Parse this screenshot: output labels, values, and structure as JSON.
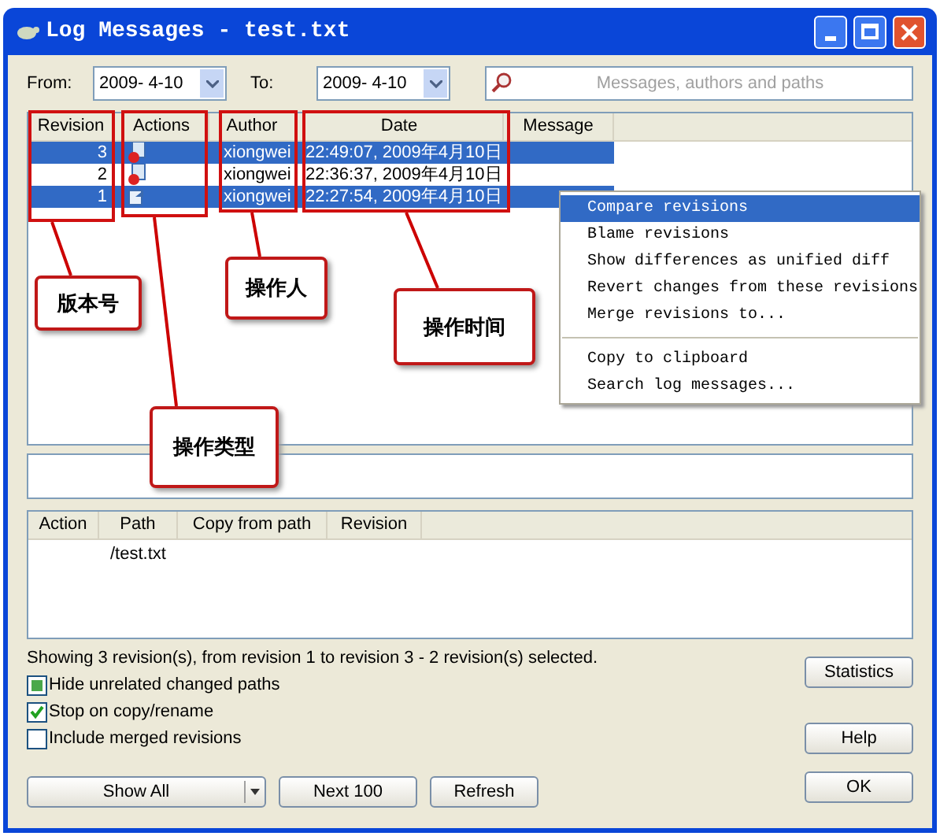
{
  "window": {
    "title": "Log Messages - test.txt"
  },
  "filter": {
    "from_label": "From:",
    "from": "2009- 4-10",
    "to_label": "To:",
    "to": "2009- 4-10",
    "search_placeholder": "Messages, authors and paths"
  },
  "log": {
    "columns": [
      "Revision",
      "Actions",
      "Author",
      "Date",
      "Message"
    ],
    "rows": [
      {
        "revision": "3",
        "kind": "modified",
        "author": "xiongwei",
        "date": "22:49:07, 2009年4月10日",
        "selected": true
      },
      {
        "revision": "2",
        "kind": "modified",
        "author": "xiongwei",
        "date": "22:36:37, 2009年4月10日",
        "selected": false
      },
      {
        "revision": "1",
        "kind": "added",
        "author": "xiongwei",
        "date": "22:27:54, 2009年4月10日",
        "selected": true
      }
    ]
  },
  "context_menu": [
    {
      "kind": "item",
      "label": "Compare revisions",
      "selected": true
    },
    {
      "kind": "item",
      "label": "Blame revisions",
      "selected": false
    },
    {
      "kind": "item",
      "label": "Show differences as unified diff",
      "selected": false
    },
    {
      "kind": "item",
      "label": "Revert changes from these revisions",
      "selected": false
    },
    {
      "kind": "item",
      "label": "Merge revisions to...",
      "selected": false
    },
    {
      "kind": "separator"
    },
    {
      "kind": "item",
      "label": "Copy to clipboard",
      "selected": false
    },
    {
      "kind": "item",
      "label": "Search log messages...",
      "selected": false
    }
  ],
  "annotations": [
    {
      "kind": "revision",
      "label": "版本号"
    },
    {
      "kind": "author",
      "label": "操作人"
    },
    {
      "kind": "date",
      "label": "操作时间"
    },
    {
      "kind": "actions",
      "label": "操作类型"
    }
  ],
  "paths": {
    "columns": [
      "Action",
      "Path",
      "Copy from path",
      "Revision"
    ],
    "rows": [
      {
        "path": "/test.txt"
      }
    ]
  },
  "status": "Showing 3 revision(s), from revision 1 to revision 3 - 2 revision(s) selected.",
  "options": [
    {
      "kind": "square",
      "label": "Hide unrelated changed paths",
      "checked": true
    },
    {
      "kind": "tick",
      "label": "Stop on copy/rename",
      "checked": true
    },
    {
      "kind": "tick",
      "label": "Include merged revisions",
      "checked": false
    }
  ],
  "side_buttons": [
    "Statistics",
    "Help"
  ],
  "buttons": {
    "show_all": "Show All",
    "next": "Next 100",
    "refresh": "Refresh",
    "ok": "OK"
  }
}
